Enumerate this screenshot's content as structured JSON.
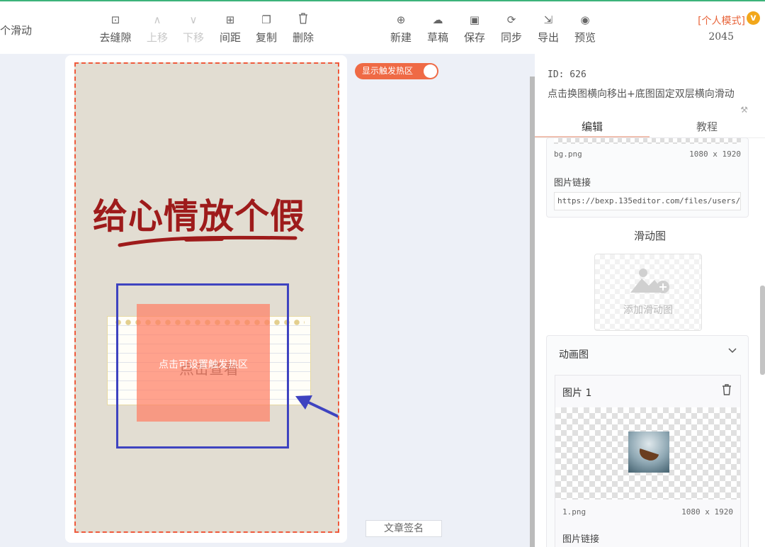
{
  "header": {
    "left_title": "个滑动",
    "tools": [
      {
        "id": "tool-remove-gap",
        "icon": "⊡",
        "icon_name": "remove-gap-icon",
        "label": "去缝隙",
        "disabled": false
      },
      {
        "id": "tool-move-up",
        "icon": "∧",
        "icon_name": "chevron-up-icon",
        "label": "上移",
        "disabled": true
      },
      {
        "id": "tool-move-down",
        "icon": "∨",
        "icon_name": "chevron-down-icon",
        "label": "下移",
        "disabled": true
      },
      {
        "id": "tool-spacing",
        "icon": "⊞",
        "icon_name": "spacing-icon",
        "label": "间距",
        "disabled": false
      },
      {
        "id": "tool-copy",
        "icon": "❐",
        "icon_name": "copy-icon",
        "label": "复制",
        "disabled": false
      },
      {
        "id": "tool-delete",
        "icon": "🗑",
        "icon_name": "trash-icon",
        "label": "删除",
        "disabled": false
      },
      {
        "id": "tool-new",
        "icon": "⊕",
        "icon_name": "new-file-icon",
        "label": "新建",
        "disabled": false
      },
      {
        "id": "tool-draft",
        "icon": "☁",
        "icon_name": "cloud-icon",
        "label": "草稿",
        "disabled": false
      },
      {
        "id": "tool-save",
        "icon": "▣",
        "icon_name": "save-icon",
        "label": "保存",
        "disabled": false
      },
      {
        "id": "tool-sync",
        "icon": "⟳",
        "icon_name": "sync-icon",
        "label": "同步",
        "disabled": false
      },
      {
        "id": "tool-export",
        "icon": "⇲",
        "icon_name": "export-icon",
        "label": "导出",
        "disabled": false
      },
      {
        "id": "tool-preview",
        "icon": "◉",
        "icon_name": "eye-icon",
        "label": "预览",
        "disabled": false
      }
    ],
    "mode_label": "[个人模式]",
    "badge": "v",
    "count": "2045"
  },
  "canvas": {
    "headline": "给心情放个假",
    "note_text": "点击查看",
    "hotspot_text": "点击可设置触发热区",
    "toggle_label": "显示触发热区",
    "signature_button": "文章签名",
    "accent_color": "#ef6a45",
    "frame_color": "#3e43c0"
  },
  "panel": {
    "id_label": "ID: 626",
    "description": "点击换图横向移出+底图固定双层横向滑动",
    "tabs": [
      "编辑",
      "教程"
    ],
    "bg_image": {
      "filename": "bg.png",
      "size": "1080 x 1920",
      "link_label": "图片链接",
      "url": "https://bexp.135editor.com/files/users/("
    },
    "slide_section_title": "滑动图",
    "add_slide_label": "添加滑动图",
    "anim_section_title": "动画图",
    "anim_image": {
      "title": "图片 1",
      "filename": "1.png",
      "size": "1080 x 1920",
      "link_label": "图片链接"
    }
  }
}
